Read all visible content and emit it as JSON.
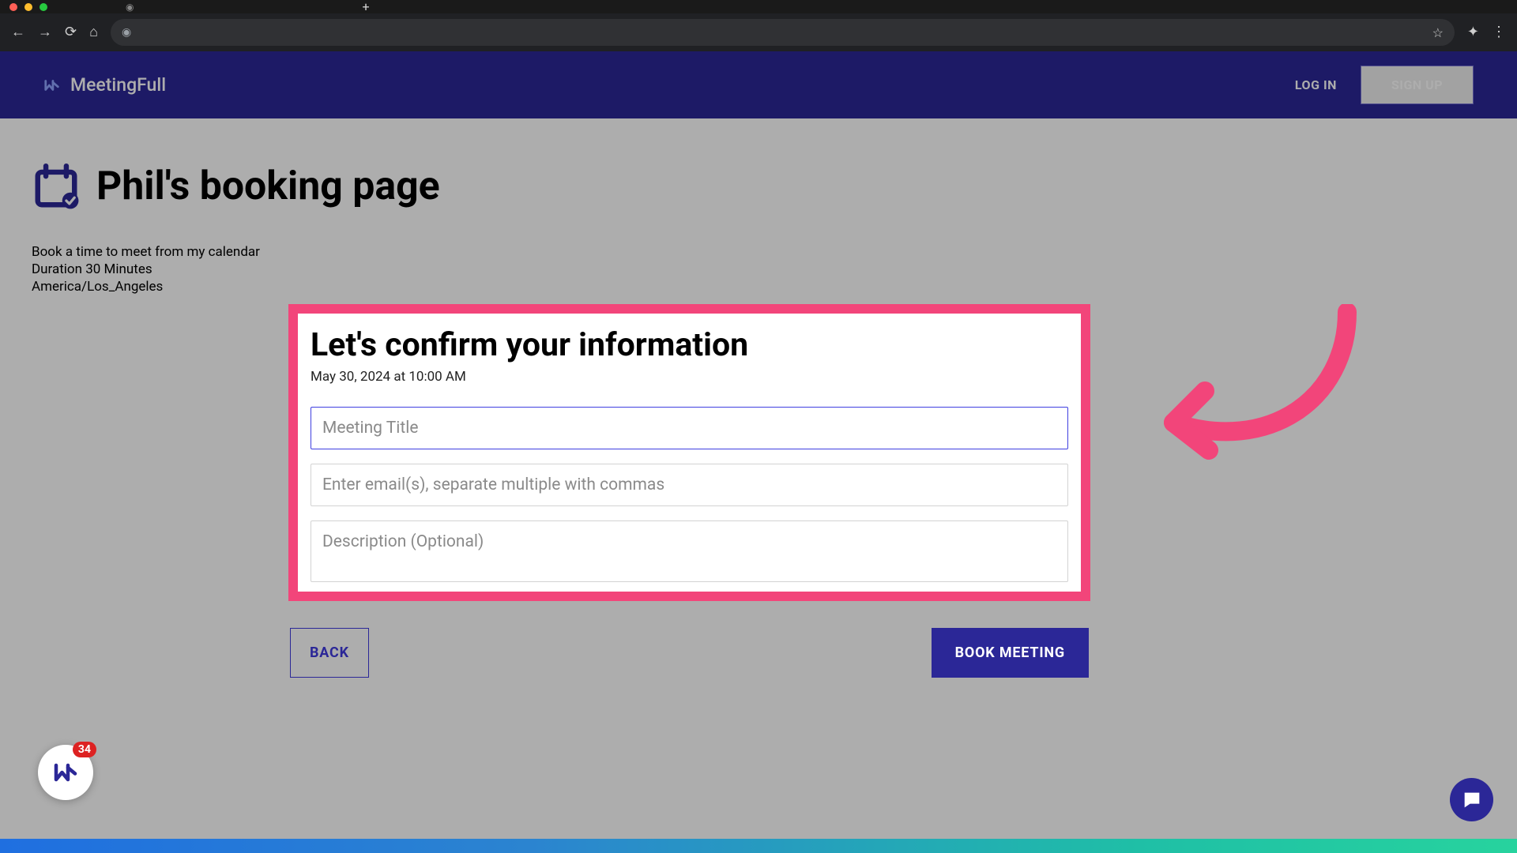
{
  "browser": {
    "nav_back": "←",
    "nav_fwd": "→",
    "reload": "⟳",
    "home": "⌂",
    "star": "☆",
    "ext": "✦",
    "menu": "⋮",
    "tab_plus": "+"
  },
  "header": {
    "brand": "MeetingFull",
    "login": "LOG IN",
    "signup": "SIGN UP"
  },
  "page": {
    "title": "Phil's booking page",
    "meta1": "Book a time to meet from my calendar",
    "meta2": "Duration 30 Minutes",
    "meta3": "America/Los_Angeles"
  },
  "dialog": {
    "title": "Let's confirm your information",
    "datetime": "May 30, 2024 at 10:00 AM",
    "meeting_title_placeholder": "Meeting Title",
    "emails_placeholder": "Enter email(s), separate multiple with commas",
    "description_placeholder": "Description (Optional)",
    "back": "BACK",
    "book": "BOOK MEETING"
  },
  "badge_count": "34"
}
